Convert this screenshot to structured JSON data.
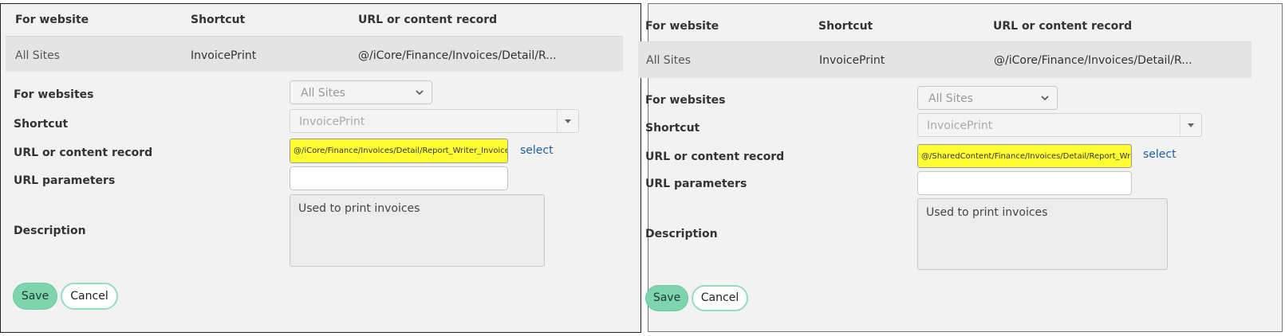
{
  "table": {
    "headers": [
      "For website",
      "Shortcut",
      "URL or content record"
    ],
    "row": {
      "website": "All Sites",
      "shortcut": "InvoicePrint",
      "url": "@/iCore/Finance/Invoices/Detail/R..."
    }
  },
  "form": {
    "labels": {
      "websites": "For websites",
      "shortcut": "Shortcut",
      "url": "URL or content record",
      "params": "URL parameters",
      "description": "Description"
    },
    "websites_value": "All Sites",
    "shortcut_value": "InvoicePrint",
    "select_link": "select",
    "description_value": "Used to print invoices",
    "save_label": "Save",
    "cancel_label": "Cancel"
  },
  "left": {
    "url_value": "@/iCore/Finance/Invoices/Detail/Report_Writer_Invoice_"
  },
  "right": {
    "url_value": "@/SharedContent/Finance/Invoices/Detail/Report_Write"
  },
  "colors": {
    "highlight": "#ffff33",
    "save_green": "#7dd4ad",
    "link_blue": "#1a5fa0"
  }
}
